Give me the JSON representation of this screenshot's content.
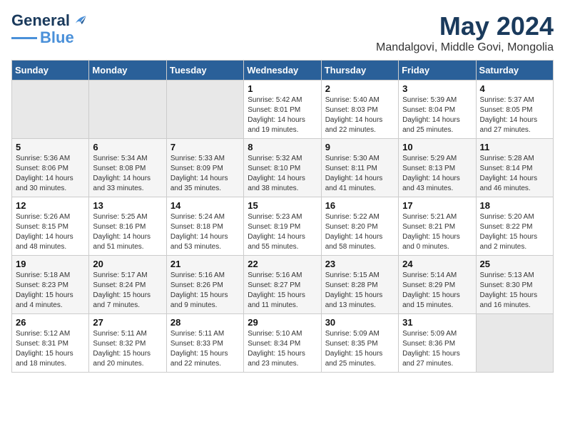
{
  "logo": {
    "line1": "General",
    "line2": "Blue"
  },
  "title": "May 2024",
  "subtitle": "Mandalgovi, Middle Govi, Mongolia",
  "days_header": [
    "Sunday",
    "Monday",
    "Tuesday",
    "Wednesday",
    "Thursday",
    "Friday",
    "Saturday"
  ],
  "weeks": [
    [
      {
        "num": "",
        "info": ""
      },
      {
        "num": "",
        "info": ""
      },
      {
        "num": "",
        "info": ""
      },
      {
        "num": "1",
        "info": "Sunrise: 5:42 AM\nSunset: 8:01 PM\nDaylight: 14 hours\nand 19 minutes."
      },
      {
        "num": "2",
        "info": "Sunrise: 5:40 AM\nSunset: 8:03 PM\nDaylight: 14 hours\nand 22 minutes."
      },
      {
        "num": "3",
        "info": "Sunrise: 5:39 AM\nSunset: 8:04 PM\nDaylight: 14 hours\nand 25 minutes."
      },
      {
        "num": "4",
        "info": "Sunrise: 5:37 AM\nSunset: 8:05 PM\nDaylight: 14 hours\nand 27 minutes."
      }
    ],
    [
      {
        "num": "5",
        "info": "Sunrise: 5:36 AM\nSunset: 8:06 PM\nDaylight: 14 hours\nand 30 minutes."
      },
      {
        "num": "6",
        "info": "Sunrise: 5:34 AM\nSunset: 8:08 PM\nDaylight: 14 hours\nand 33 minutes."
      },
      {
        "num": "7",
        "info": "Sunrise: 5:33 AM\nSunset: 8:09 PM\nDaylight: 14 hours\nand 35 minutes."
      },
      {
        "num": "8",
        "info": "Sunrise: 5:32 AM\nSunset: 8:10 PM\nDaylight: 14 hours\nand 38 minutes."
      },
      {
        "num": "9",
        "info": "Sunrise: 5:30 AM\nSunset: 8:11 PM\nDaylight: 14 hours\nand 41 minutes."
      },
      {
        "num": "10",
        "info": "Sunrise: 5:29 AM\nSunset: 8:13 PM\nDaylight: 14 hours\nand 43 minutes."
      },
      {
        "num": "11",
        "info": "Sunrise: 5:28 AM\nSunset: 8:14 PM\nDaylight: 14 hours\nand 46 minutes."
      }
    ],
    [
      {
        "num": "12",
        "info": "Sunrise: 5:26 AM\nSunset: 8:15 PM\nDaylight: 14 hours\nand 48 minutes."
      },
      {
        "num": "13",
        "info": "Sunrise: 5:25 AM\nSunset: 8:16 PM\nDaylight: 14 hours\nand 51 minutes."
      },
      {
        "num": "14",
        "info": "Sunrise: 5:24 AM\nSunset: 8:18 PM\nDaylight: 14 hours\nand 53 minutes."
      },
      {
        "num": "15",
        "info": "Sunrise: 5:23 AM\nSunset: 8:19 PM\nDaylight: 14 hours\nand 55 minutes."
      },
      {
        "num": "16",
        "info": "Sunrise: 5:22 AM\nSunset: 8:20 PM\nDaylight: 14 hours\nand 58 minutes."
      },
      {
        "num": "17",
        "info": "Sunrise: 5:21 AM\nSunset: 8:21 PM\nDaylight: 15 hours\nand 0 minutes."
      },
      {
        "num": "18",
        "info": "Sunrise: 5:20 AM\nSunset: 8:22 PM\nDaylight: 15 hours\nand 2 minutes."
      }
    ],
    [
      {
        "num": "19",
        "info": "Sunrise: 5:18 AM\nSunset: 8:23 PM\nDaylight: 15 hours\nand 4 minutes."
      },
      {
        "num": "20",
        "info": "Sunrise: 5:17 AM\nSunset: 8:24 PM\nDaylight: 15 hours\nand 7 minutes."
      },
      {
        "num": "21",
        "info": "Sunrise: 5:16 AM\nSunset: 8:26 PM\nDaylight: 15 hours\nand 9 minutes."
      },
      {
        "num": "22",
        "info": "Sunrise: 5:16 AM\nSunset: 8:27 PM\nDaylight: 15 hours\nand 11 minutes."
      },
      {
        "num": "23",
        "info": "Sunrise: 5:15 AM\nSunset: 8:28 PM\nDaylight: 15 hours\nand 13 minutes."
      },
      {
        "num": "24",
        "info": "Sunrise: 5:14 AM\nSunset: 8:29 PM\nDaylight: 15 hours\nand 15 minutes."
      },
      {
        "num": "25",
        "info": "Sunrise: 5:13 AM\nSunset: 8:30 PM\nDaylight: 15 hours\nand 16 minutes."
      }
    ],
    [
      {
        "num": "26",
        "info": "Sunrise: 5:12 AM\nSunset: 8:31 PM\nDaylight: 15 hours\nand 18 minutes."
      },
      {
        "num": "27",
        "info": "Sunrise: 5:11 AM\nSunset: 8:32 PM\nDaylight: 15 hours\nand 20 minutes."
      },
      {
        "num": "28",
        "info": "Sunrise: 5:11 AM\nSunset: 8:33 PM\nDaylight: 15 hours\nand 22 minutes."
      },
      {
        "num": "29",
        "info": "Sunrise: 5:10 AM\nSunset: 8:34 PM\nDaylight: 15 hours\nand 23 minutes."
      },
      {
        "num": "30",
        "info": "Sunrise: 5:09 AM\nSunset: 8:35 PM\nDaylight: 15 hours\nand 25 minutes."
      },
      {
        "num": "31",
        "info": "Sunrise: 5:09 AM\nSunset: 8:36 PM\nDaylight: 15 hours\nand 27 minutes."
      },
      {
        "num": "",
        "info": ""
      }
    ]
  ]
}
